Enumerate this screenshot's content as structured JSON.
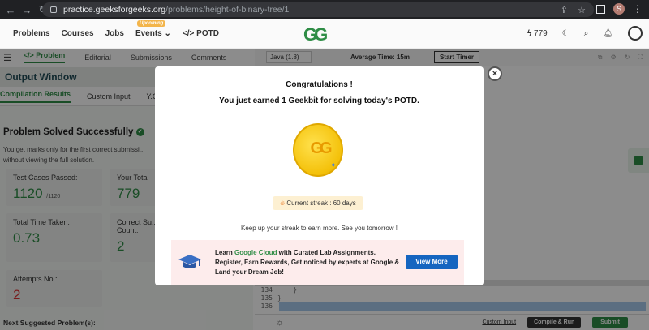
{
  "browser": {
    "url_domain": "practice.geeksforgeeks.org",
    "url_path": "/problems/height-of-binary-tree/1",
    "avatar_letter": "S"
  },
  "site_header": {
    "nav": [
      "Problems",
      "Courses",
      "Jobs",
      "Events"
    ],
    "events_badge": "Upcoming",
    "potd": "</> POTD",
    "logo": "GG",
    "streak_count": "779"
  },
  "problem_tabs": [
    "</> Problem",
    "Editorial",
    "Submissions",
    "Comments"
  ],
  "editor_toolbar": {
    "language": "Java (1.8)",
    "average_time": "Average Time: 15m",
    "start_timer": "Start Timer"
  },
  "output": {
    "title": "Output Window",
    "tabs": [
      "Compilation Results",
      "Custom Input",
      "Y.O.G"
    ],
    "solved_title": "Problem Solved Successfully",
    "note": "You get marks only for the first correct submissi... without viewing the full solution.",
    "cards": {
      "test_cases_label": "Test Cases Passed:",
      "test_cases_value": "1120",
      "test_cases_total": "/1120",
      "your_total_label": "Your Total",
      "your_total_value": "779",
      "time_label": "Total Time Taken:",
      "time_value": "0.73",
      "correct_label": "Correct Su... Count:",
      "correct_value": "2",
      "attempts_label": "Attempts No.:",
      "attempts_value": "2"
    },
    "next_suggested": "Next Suggested Problem(s):"
  },
  "editor": {
    "lines": [
      {
        "num": "134",
        "code": "    }"
      },
      {
        "num": "135",
        "code": "}"
      },
      {
        "num": "136",
        "code": ""
      }
    ]
  },
  "bottom": {
    "custom_input": "Custom Input",
    "compile": "Compile & Run",
    "submit": "Submit"
  },
  "modal": {
    "title": "Congratulations !",
    "subtitle": "You just earned 1 Geekbit for solving today's POTD.",
    "coin_logo": "GG",
    "streak": "Current streak : 60 days",
    "keep": "Keep up your streak to earn more. See you tomorrow !",
    "promo_pre": "Learn ",
    "promo_highlight": "Google Cloud",
    "promo_post": " with Curated Lab Assignments. Register, Earn Rewards, Get noticed by experts at Google & Land your Dream Job!",
    "view_more": "View More",
    "close": "×"
  },
  "colors": {
    "accent": "#2f8d46",
    "button_blue": "#1565c0",
    "promo_bg": "#fdecec"
  }
}
